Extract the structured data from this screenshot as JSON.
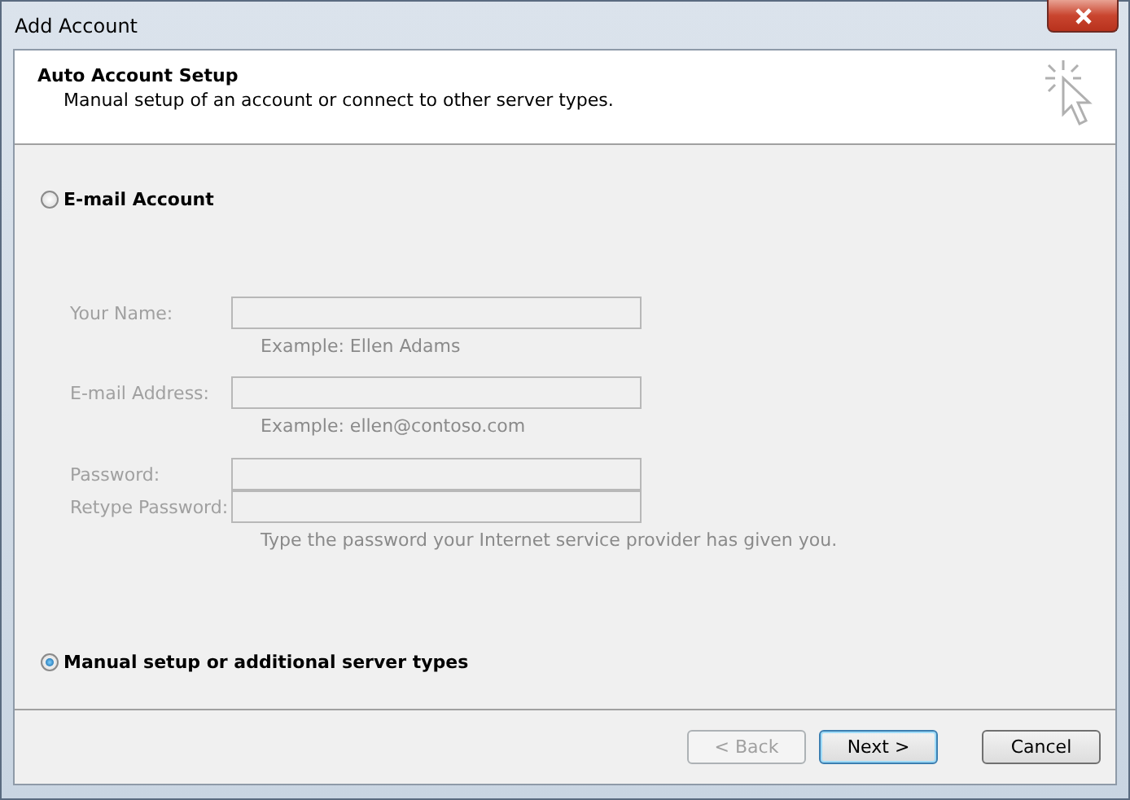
{
  "window": {
    "title": "Add Account"
  },
  "header": {
    "title": "Auto Account Setup",
    "subtitle": "Manual setup of an account or connect to other server types."
  },
  "options": [
    {
      "label": "E-mail Account",
      "selected": false
    },
    {
      "label": "Manual setup or additional server types",
      "selected": true
    }
  ],
  "fields": [
    {
      "label": "Your Name:",
      "disabled": true,
      "hint": "Example: Ellen Adams"
    },
    {
      "label": "E-mail Address:",
      "disabled": true,
      "hint": "Example: ellen@contoso.com"
    },
    {
      "label": "Password:",
      "disabled": true
    },
    {
      "label": "Retype Password:",
      "disabled": true,
      "hint": "Type the password your Internet service provider has given you."
    }
  ],
  "buttons": [
    {
      "label": "< Back",
      "disabled": true,
      "default": false
    },
    {
      "label": "Next >",
      "disabled": false,
      "default": true
    },
    {
      "label": "Cancel",
      "disabled": false,
      "default": false
    }
  ]
}
